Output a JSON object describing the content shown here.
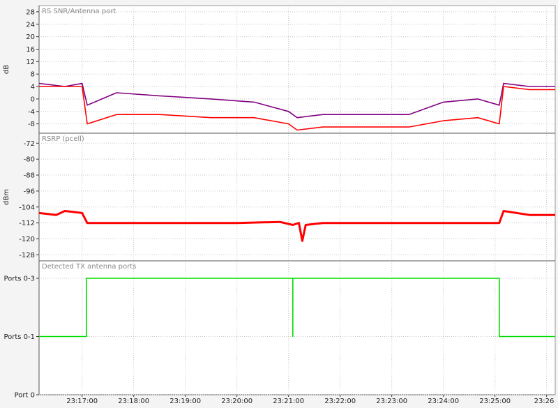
{
  "chart_data": [
    {
      "type": "line",
      "title": "RS SNR/Antenna port",
      "ylabel": "dB",
      "ylim": [
        -11,
        30
      ],
      "yticks": [
        28,
        24,
        20,
        16,
        12,
        8,
        4,
        0,
        -4,
        -8
      ],
      "series": [
        {
          "color": "#800080",
          "x": [
            "23:16:10",
            "23:16:40",
            "23:17:00",
            "23:17:06",
            "23:17:40",
            "23:18:30",
            "23:19:30",
            "23:20:20",
            "23:21:00",
            "23:21:10",
            "23:21:40",
            "23:22:30",
            "23:23:20",
            "23:24:00",
            "23:24:40",
            "23:25:05",
            "23:25:10",
            "23:25:40",
            "23:26:10"
          ],
          "y": [
            5,
            4,
            5,
            -2,
            2,
            1,
            0,
            -1,
            -4,
            -6,
            -5,
            -5,
            -5,
            -1,
            0,
            -2,
            5,
            4,
            4
          ]
        },
        {
          "color": "#ff0000",
          "x": [
            "23:16:10",
            "23:16:40",
            "23:17:00",
            "23:17:06",
            "23:17:40",
            "23:18:30",
            "23:19:30",
            "23:20:20",
            "23:21:00",
            "23:21:10",
            "23:21:40",
            "23:22:30",
            "23:23:20",
            "23:24:00",
            "23:24:40",
            "23:25:05",
            "23:25:10",
            "23:25:40",
            "23:26:10"
          ],
          "y": [
            4,
            4,
            4,
            -8,
            -5,
            -5,
            -6,
            -6,
            -8,
            -10,
            -9,
            -9,
            -9,
            -7,
            -6,
            -8,
            4,
            3,
            3
          ]
        }
      ]
    },
    {
      "type": "line",
      "title": "RSRP (pcell)",
      "ylabel": "dBm",
      "ylim": [
        -131,
        -67
      ],
      "yticks": [
        -72,
        -80,
        -88,
        -96,
        -104,
        -112,
        -120,
        -128
      ],
      "series": [
        {
          "color": "#ff0000",
          "x": [
            "23:16:10",
            "23:16:30",
            "23:16:40",
            "23:17:00",
            "23:17:06",
            "23:18:00",
            "23:19:00",
            "23:20:00",
            "23:20:50",
            "23:21:05",
            "23:21:12",
            "23:21:16",
            "23:21:20",
            "23:21:40",
            "23:22:30",
            "23:23:30",
            "23:24:30",
            "23:25:05",
            "23:25:10",
            "23:25:40",
            "23:26:10"
          ],
          "y": [
            -107,
            -108,
            -106,
            -107,
            -112,
            -112,
            -112,
            -112,
            -111.5,
            -113,
            -112,
            -121,
            -113,
            -112,
            -112,
            -112,
            -112,
            -112,
            -106,
            -108,
            -108
          ]
        }
      ]
    },
    {
      "type": "line",
      "title": "Detected TX antenna ports",
      "ylabel": "",
      "ylim": [
        0,
        2.3
      ],
      "yticks": [
        "Ports 0-3",
        "Ports 0-1",
        "Port 0"
      ],
      "series": [
        {
          "color": "#00dd00",
          "x": [
            "23:16:10",
            "23:17:05",
            "23:17:05",
            "23:21:05",
            "23:21:05",
            "23:21:05",
            "23:21:05",
            "23:25:05",
            "23:25:05",
            "23:26:10"
          ],
          "y": [
            1,
            1,
            2,
            2,
            1,
            1,
            2,
            2,
            1,
            1
          ]
        }
      ]
    }
  ],
  "x_axis": {
    "ticks": [
      "23:17:00",
      "23:18:00",
      "23:19:00",
      "23:20:00",
      "23:21:00",
      "23:22:00",
      "23:23:00",
      "23:24:00",
      "23:25:00",
      "23:26"
    ]
  }
}
